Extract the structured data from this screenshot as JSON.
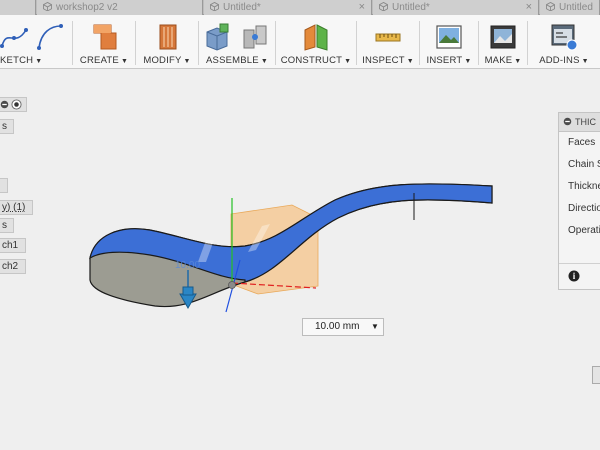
{
  "tabs": [
    {
      "title": "workshop2 v2"
    },
    {
      "title": "Untitled*"
    },
    {
      "title": "Untitled*"
    },
    {
      "title": "Untitled"
    }
  ],
  "toolbar": {
    "groups": [
      {
        "label": "SKETCH",
        "display": "KETCH"
      },
      {
        "label": "CREATE"
      },
      {
        "label": "MODIFY"
      },
      {
        "label": "ASSEMBLE"
      },
      {
        "label": "CONSTRUCT"
      },
      {
        "label": "INSPECT"
      },
      {
        "label": "INSERT"
      },
      {
        "label": "MAKE"
      },
      {
        "label": "ADD-INS"
      }
    ],
    "caret": "▼"
  },
  "browser": {
    "rows": [
      "s",
      "",
      "",
      "y) (1)",
      "s",
      "ch1",
      "ch2"
    ]
  },
  "thicken_panel": {
    "title": "THICKEN",
    "display_title": "THIC",
    "rows": [
      "Faces",
      "Chain S",
      "Thickne",
      "Directio",
      "Operati"
    ],
    "info_glyph": "i"
  },
  "dimension": {
    "value": "10.00 mm",
    "caret": "▼",
    "viewport_label": "10.00"
  },
  "colors": {
    "accent_blue": "#3c6fd6",
    "solid_gray": "#9b9b91",
    "plane_orange": "#f5c489",
    "axis_red": "#e02020",
    "axis_green": "#24c024",
    "axis_blue": "#2050e0",
    "arrow_blue": "#2a86c6"
  }
}
